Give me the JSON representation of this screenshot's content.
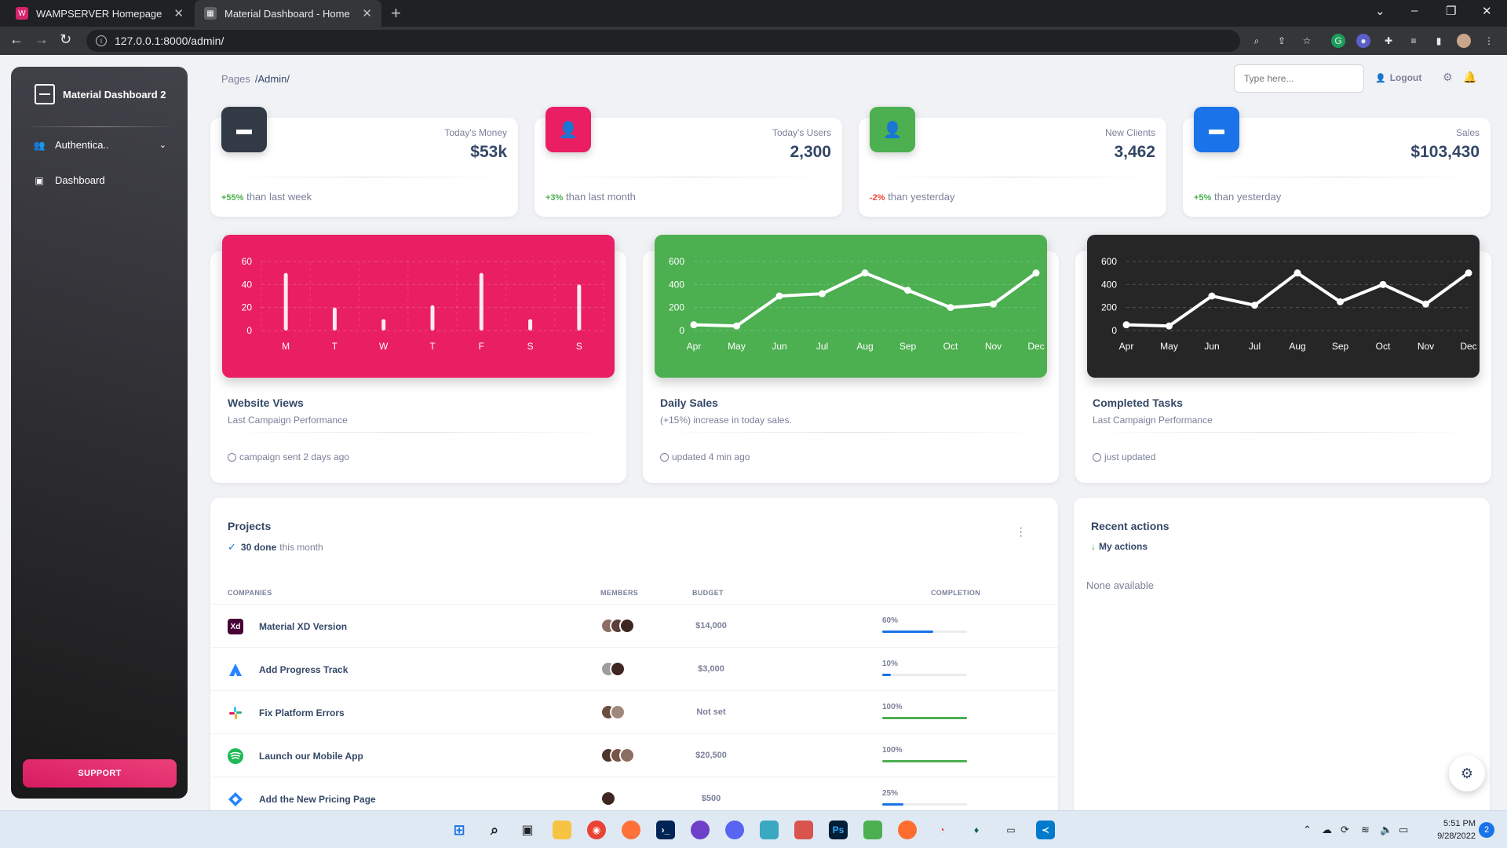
{
  "browser": {
    "tabs": [
      {
        "title": "WAMPSERVER Homepage",
        "favicon_color": "#d6246e"
      },
      {
        "title": "Material Dashboard - Home",
        "favicon_color": "#5f6368"
      }
    ],
    "url": "127.0.0.1:8000/admin/"
  },
  "sidebar": {
    "brand": "Material Dashboard 2",
    "items": [
      {
        "label": "Authentica..",
        "icon": "users-icon"
      },
      {
        "label": "Dashboard",
        "icon": "dashboard-icon"
      }
    ],
    "support_label": "SUPPORT"
  },
  "navbar": {
    "breadcrumb_root": "Pages",
    "breadcrumb_current": "/Admin/",
    "search_placeholder": "Type here...",
    "logout_label": "Logout"
  },
  "stats": [
    {
      "label": "Today's Money",
      "value": "$53k",
      "change": "+55%",
      "change_text": "than last week",
      "change_color": "#4caf50",
      "icon_bg": "#323a46"
    },
    {
      "label": "Today's Users",
      "value": "2,300",
      "change": "+3%",
      "change_text": "than last month",
      "change_color": "#4caf50",
      "icon_bg": "#e91e63"
    },
    {
      "label": "New Clients",
      "value": "3,462",
      "change": "-2%",
      "change_text": "than yesterday",
      "change_color": "#f44335",
      "icon_bg": "#4caf50"
    },
    {
      "label": "Sales",
      "value": "$103,430",
      "change": "+5%",
      "change_text": "than yesterday",
      "change_color": "#4caf50",
      "icon_bg": "#1a73e8"
    }
  ],
  "chart_cards": [
    {
      "title": "Website Views",
      "subtitle": "Last Campaign Performance",
      "footer": "campaign sent 2 days ago",
      "bg": "#e91e63"
    },
    {
      "title": "Daily Sales",
      "subtitle_bold": "(+15%)",
      "subtitle": "increase in today sales.",
      "footer": "updated 4 min ago",
      "bg": "#4caf50"
    },
    {
      "title": "Completed Tasks",
      "subtitle": "Last Campaign Performance",
      "footer": "just updated",
      "bg": "#262626"
    }
  ],
  "chart_data": [
    {
      "type": "bar",
      "title": "Website Views",
      "categories": [
        "M",
        "T",
        "W",
        "T",
        "F",
        "S",
        "S"
      ],
      "values": [
        50,
        20,
        10,
        22,
        50,
        10,
        40
      ],
      "yticks": [
        0,
        20,
        40,
        60
      ],
      "ylim": [
        0,
        60
      ],
      "grid": true
    },
    {
      "type": "line",
      "title": "Daily Sales",
      "categories": [
        "Apr",
        "May",
        "Jun",
        "Jul",
        "Aug",
        "Sep",
        "Oct",
        "Nov",
        "Dec"
      ],
      "values": [
        50,
        40,
        300,
        320,
        500,
        350,
        200,
        230,
        500
      ],
      "yticks": [
        0,
        200,
        400,
        600
      ],
      "ylim": [
        0,
        600
      ],
      "grid": true
    },
    {
      "type": "line",
      "title": "Completed Tasks",
      "categories": [
        "Apr",
        "May",
        "Jun",
        "Jul",
        "Aug",
        "Sep",
        "Oct",
        "Nov",
        "Dec"
      ],
      "values": [
        50,
        40,
        300,
        220,
        500,
        250,
        400,
        230,
        500
      ],
      "yticks": [
        0,
        200,
        400,
        600
      ],
      "ylim": [
        0,
        600
      ],
      "grid": true
    }
  ],
  "projects": {
    "title": "Projects",
    "done_count": "30 done",
    "done_suffix": "this month",
    "columns": [
      "COMPANIES",
      "MEMBERS",
      "BUDGET",
      "COMPLETION"
    ],
    "rows": [
      {
        "company": "Material XD Version",
        "icon": "xd-icon",
        "icon_bg": "#470137",
        "icon_text": "Xd",
        "members": 3,
        "budget": "$14,000",
        "completion": "60%",
        "progress": 60,
        "bar_color": "#1a73e8"
      },
      {
        "company": "Add Progress Track",
        "icon": "atlassian-icon",
        "icon_bg": "#ffffff",
        "icon_text": "",
        "members": 2,
        "budget": "$3,000",
        "completion": "10%",
        "progress": 10,
        "bar_color": "#1a73e8"
      },
      {
        "company": "Fix Platform Errors",
        "icon": "slack-icon",
        "icon_bg": "#ffffff",
        "icon_text": "",
        "members": 2,
        "budget": "Not set",
        "completion": "100%",
        "progress": 100,
        "bar_color": "#4caf50"
      },
      {
        "company": "Launch our Mobile App",
        "icon": "spotify-icon",
        "icon_bg": "#1db954",
        "icon_text": "",
        "members": 3,
        "budget": "$20,500",
        "completion": "100%",
        "progress": 100,
        "bar_color": "#4caf50"
      },
      {
        "company": "Add the New Pricing Page",
        "icon": "jira-icon",
        "icon_bg": "#ffffff",
        "icon_text": "",
        "members": 1,
        "budget": "$500",
        "completion": "25%",
        "progress": 25,
        "bar_color": "#1a73e8"
      }
    ]
  },
  "recent_actions": {
    "title": "Recent actions",
    "subtitle": "My actions",
    "empty": "None available"
  },
  "taskbar": {
    "time": "5:51 PM",
    "date": "9/28/2022",
    "notifications": "2"
  }
}
